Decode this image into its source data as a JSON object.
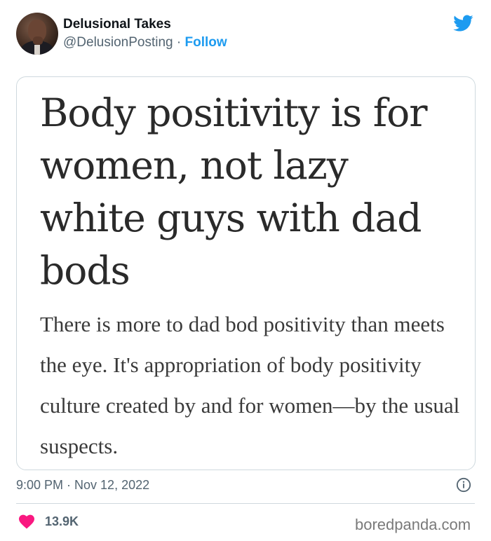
{
  "author": {
    "name": "Delusional Takes",
    "handle": "@DelusionPosting",
    "separator": " · ",
    "follow_label": "Follow"
  },
  "media": {
    "headline": "Body positivity is for women, not lazy white guys with dad bods",
    "subheadline": "There is more to dad bod positivity than meets the eye. It's appropriation of body positivity culture created by and for women—by the usual suspects."
  },
  "meta": {
    "timestamp": "9:00 PM · Nov 12, 2022"
  },
  "engagement": {
    "likes": "13.9K"
  },
  "watermark": "boredpanda.com",
  "colors": {
    "accent": "#1d9bf0",
    "heart": "#f91880",
    "secondary_text": "#536471"
  },
  "icons": [
    "twitter-bird-icon",
    "info-icon",
    "heart-icon"
  ]
}
